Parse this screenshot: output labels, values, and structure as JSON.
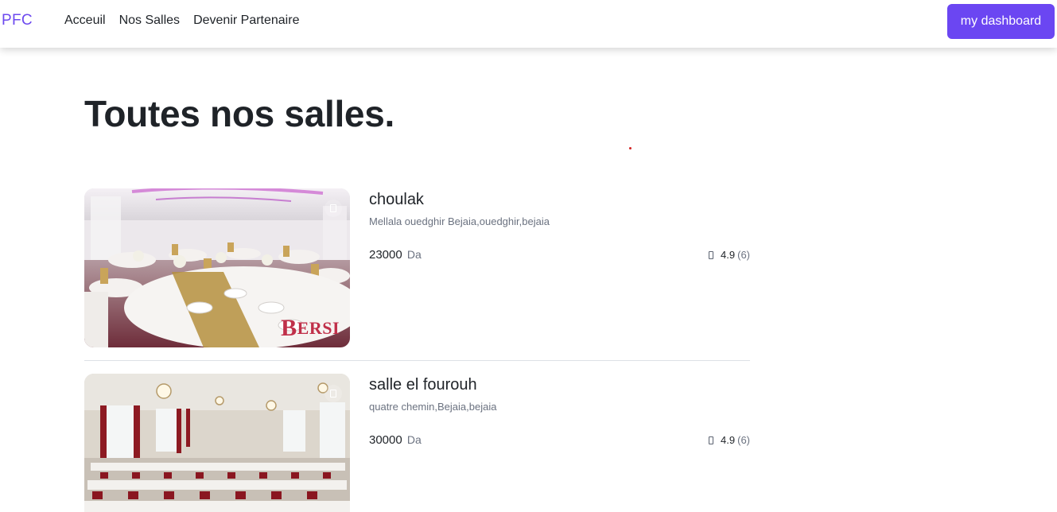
{
  "nav": {
    "brand": "PFC",
    "links": [
      "Acceuil",
      "Nos Salles",
      "Devenir Partenaire"
    ],
    "dashboard_button": "my dashboard"
  },
  "page": {
    "title": "Toutes nos salles."
  },
  "listings": [
    {
      "name": "choulak",
      "address": "Mellala ouedghir Bejaia,ouedghir,bejaia",
      "price": "23000",
      "currency": "Da",
      "rating": "4.9",
      "review_count": "(6)",
      "watermark_initial": "B",
      "watermark_text": "ERSI"
    },
    {
      "name": "salle el fourouh",
      "address": "quatre chemin,Bejaia,bejaia",
      "price": "30000",
      "currency": "Da",
      "rating": "4.9",
      "review_count": "(6)"
    }
  ],
  "colors": {
    "accent": "#6b46f2",
    "brand": "#6d4aef",
    "text": "#1f2328",
    "muted": "#6b7280"
  },
  "icons": {
    "favorite": "bookmark-icon",
    "rating": "star-icon"
  }
}
